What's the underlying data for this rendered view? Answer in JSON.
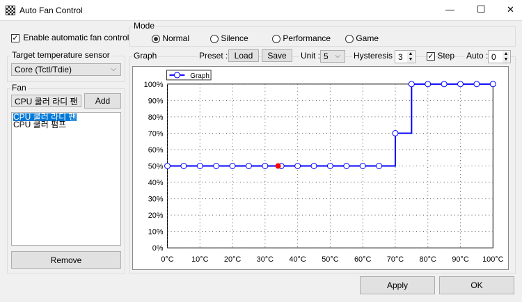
{
  "window": {
    "title": "Auto Fan Control",
    "minimize": "—",
    "maximize": "☐",
    "close": "✕"
  },
  "left": {
    "enable_label": "Enable automatic fan control",
    "enable_checked": true,
    "sensor_group": "Target temperature sensor",
    "sensor_value": "Core (Tctl/Tdie)",
    "fan_group": "Fan",
    "fan_select": "CPU 쿨러 라디 팬",
    "add_label": "Add",
    "fan_list": [
      "CPU 쿨러 라디 팬",
      "CPU 쿨러 펌프"
    ],
    "remove_label": "Remove"
  },
  "mode": {
    "label": "Mode",
    "options": [
      "Normal",
      "Silence",
      "Performance",
      "Game"
    ],
    "selected": "Normal"
  },
  "graph": {
    "label": "Graph",
    "preset_label": "Preset :",
    "load": "Load",
    "save": "Save",
    "unit_label": "Unit :",
    "unit_value": "5",
    "hysteresis_label": "Hysteresis :",
    "hysteresis_value": "3",
    "step_label": "Step",
    "step_checked": true,
    "auto_label": "Auto :",
    "auto_value": "0"
  },
  "footer": {
    "apply": "Apply",
    "ok": "OK"
  },
  "chart_data": {
    "type": "line",
    "legend": "Graph",
    "x": [
      0,
      5,
      10,
      15,
      20,
      25,
      30,
      35,
      40,
      45,
      50,
      55,
      60,
      65,
      70,
      75,
      80,
      85,
      90,
      95,
      100
    ],
    "values": [
      50,
      50,
      50,
      50,
      50,
      50,
      50,
      50,
      50,
      50,
      50,
      50,
      50,
      50,
      70,
      100,
      100,
      100,
      100,
      100,
      100
    ],
    "step": true,
    "current_point": {
      "x": 34,
      "y": 50
    },
    "xticks": [
      "0°C",
      "10°C",
      "20°C",
      "30°C",
      "40°C",
      "50°C",
      "60°C",
      "70°C",
      "80°C",
      "90°C",
      "100°C"
    ],
    "yticks": [
      "0%",
      "10%",
      "20%",
      "30%",
      "40%",
      "50%",
      "60%",
      "70%",
      "80%",
      "90%",
      "100%"
    ],
    "xlim": [
      0,
      100
    ],
    "ylim": [
      0,
      100
    ],
    "colors": {
      "line": "#0000ff",
      "current": "#ff0000"
    }
  }
}
